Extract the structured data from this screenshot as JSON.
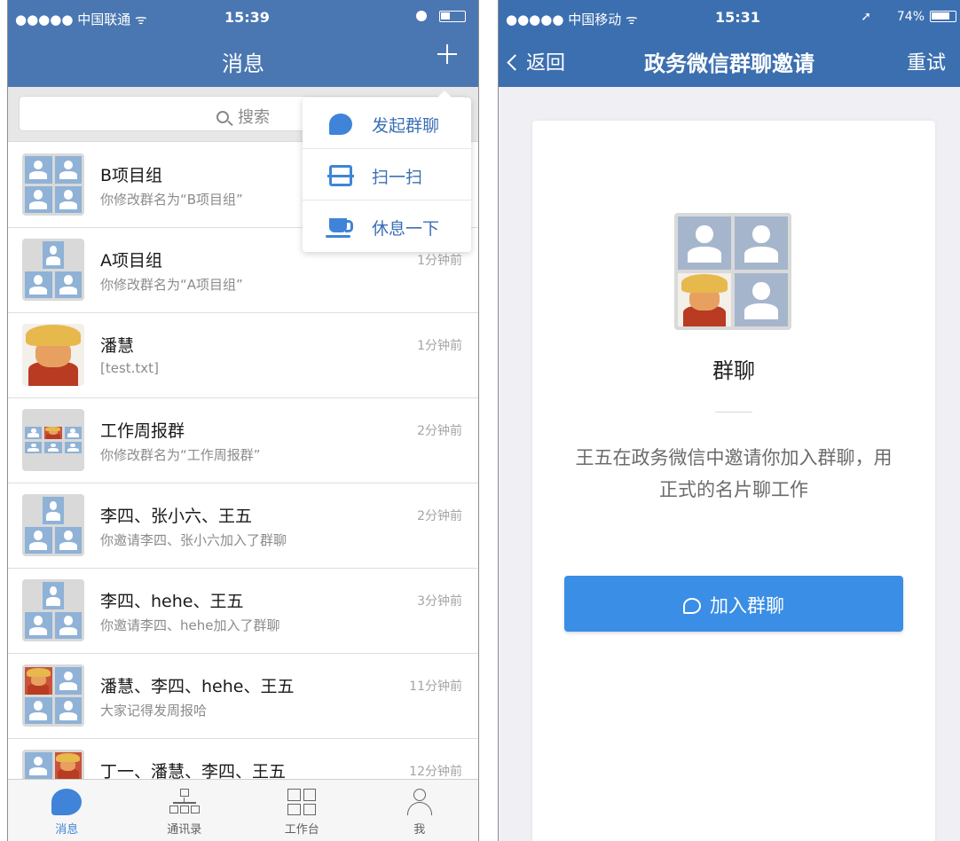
{
  "left": {
    "status": {
      "carrier": "●●●●● 中国联通 ᯤ",
      "time": "15:39"
    },
    "nav": {
      "title": "消息"
    },
    "search": {
      "placeholder": "搜索"
    },
    "popup": [
      {
        "label": "发起群聊",
        "icon": "chat-bubble-icon"
      },
      {
        "label": "扫一扫",
        "icon": "scan-icon"
      },
      {
        "label": "休息一下",
        "icon": "coffee-cup-icon"
      }
    ],
    "chats": [
      {
        "name": "B项目组",
        "message": "你修改群名为“B项目组”",
        "time": ""
      },
      {
        "name": "A项目组",
        "message": "你修改群名为“A项目组”",
        "time": "1分钟前"
      },
      {
        "name": "潘慧",
        "message": "[test.txt]",
        "time": "1分钟前"
      },
      {
        "name": "工作周报群",
        "message": "你修改群名为“工作周报群”",
        "time": "2分钟前"
      },
      {
        "name": "李四、张小六、王五",
        "message": "你邀请李四、张小六加入了群聊",
        "time": "2分钟前"
      },
      {
        "name": "李四、hehe、王五",
        "message": "你邀请李四、hehe加入了群聊",
        "time": "3分钟前"
      },
      {
        "name": "潘慧、李四、hehe、王五",
        "message": "大家记得发周报哈",
        "time": "11分钟前"
      },
      {
        "name": "丁一、潘慧、李四、王五",
        "message": "",
        "time": "12分钟前"
      }
    ],
    "tabs": [
      {
        "label": "消息",
        "icon": "message-icon",
        "active": true
      },
      {
        "label": "通讯录",
        "icon": "org-chart-icon",
        "active": false
      },
      {
        "label": "工作台",
        "icon": "grid-icon",
        "active": false
      },
      {
        "label": "我",
        "icon": "person-icon",
        "active": false
      }
    ]
  },
  "right": {
    "status": {
      "carrier": "●●●●● 中国移动 ᯤ",
      "time": "15:31",
      "battery": "74%"
    },
    "nav": {
      "back_label": "返回",
      "title": "政务微信群聊邀请",
      "retry_label": "重试"
    },
    "group_name": "群聊",
    "invite_text": "王五在政务微信中邀请你加入群聊，用正式的名片聊工作",
    "join_button": "加入群聊"
  },
  "colors": {
    "nav_bar": "#4a77b1",
    "accent": "#3f84d8",
    "button": "#3a8ee6"
  }
}
